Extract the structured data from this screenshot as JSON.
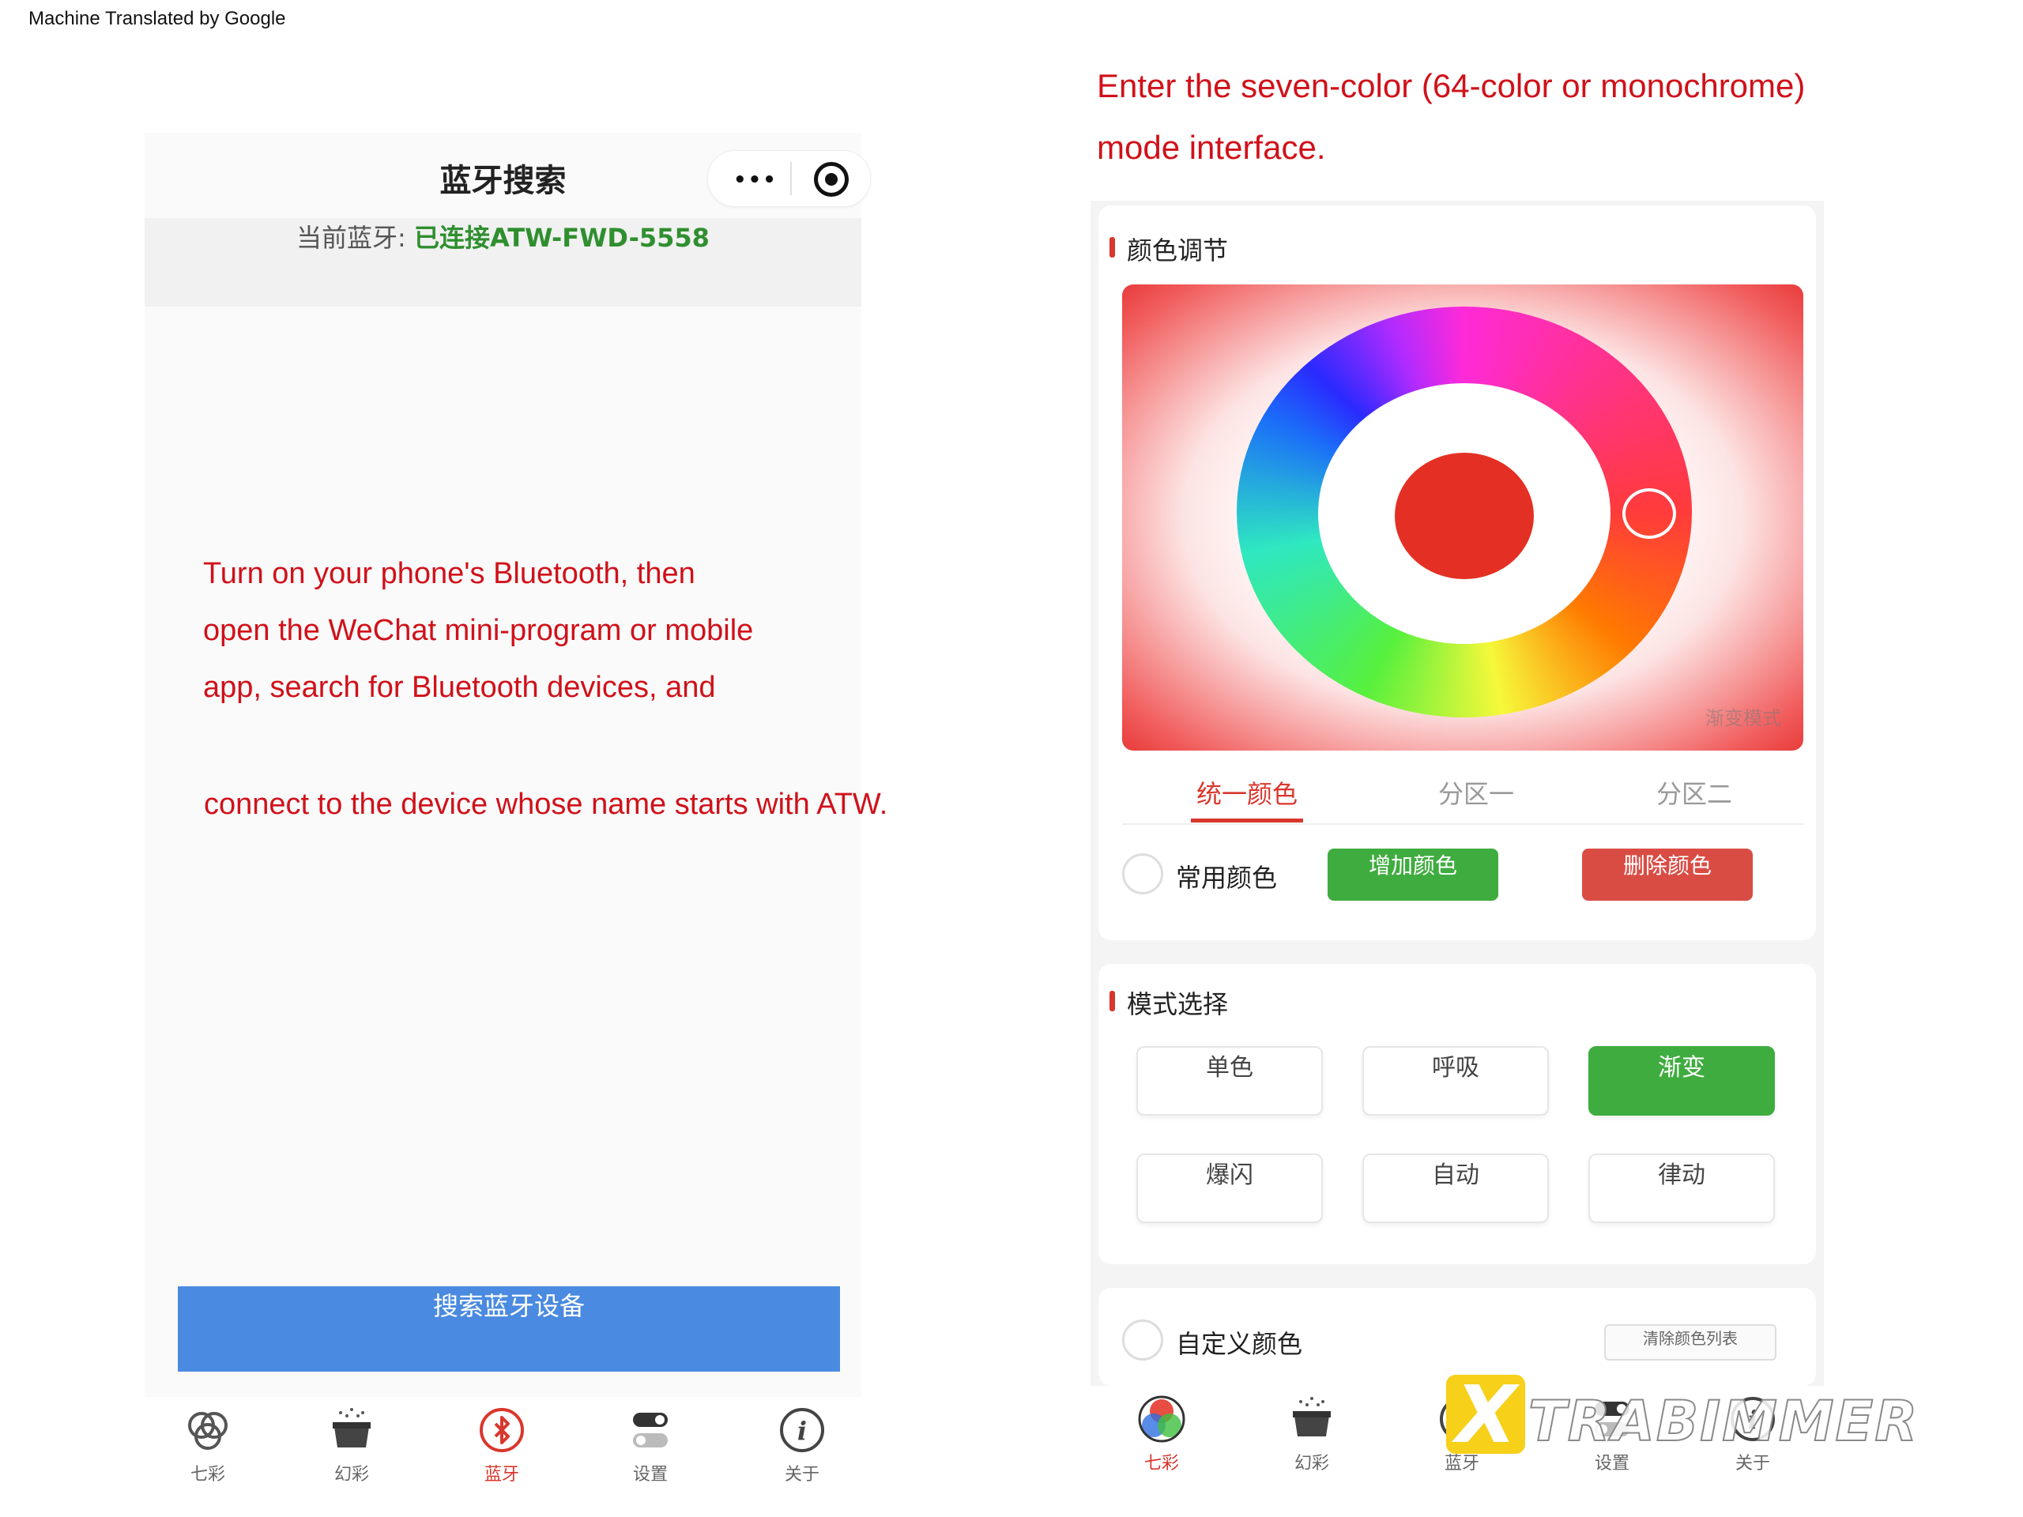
{
  "header_note": "Machine Translated by Google",
  "left_phone": {
    "nav_title": "蓝牙搜索",
    "capsule_more": "•••",
    "status_label": "当前蓝牙:",
    "status_value": "已连接ATW-FWD-5558",
    "search_button": "搜索蓝牙设备",
    "tabs": [
      {
        "label": "七彩",
        "icon": "rings-icon"
      },
      {
        "label": "幻彩",
        "icon": "magic-box-icon"
      },
      {
        "label": "蓝牙",
        "icon": "bluetooth-icon"
      },
      {
        "label": "设置",
        "icon": "toggle-icon"
      },
      {
        "label": "关于",
        "icon": "info-icon"
      }
    ]
  },
  "instructions": {
    "line1": "Turn on your phone's Bluetooth, then",
    "line2": "open the WeChat mini-program or mobile",
    "line3": "app, search for Bluetooth devices, and",
    "line4": "connect to the device whose name starts with ATW."
  },
  "right_note": {
    "line1": "Enter the seven-color (64-color or monochrome)",
    "line2": "mode interface."
  },
  "right_phone": {
    "color_title": "颜色调节",
    "wheel_caption": "渐变模式",
    "segments": [
      "统一颜色",
      "分区一",
      "分区二"
    ],
    "active_segment": "统一颜色",
    "common_color_label": "常用颜色",
    "add_color_button": "增加颜色",
    "delete_color_button": "删除颜色",
    "mode_title": "模式选择",
    "modes": [
      "单色",
      "呼吸",
      "渐变",
      "爆闪",
      "自动",
      "律动"
    ],
    "active_mode": "渐变",
    "custom_color_label": "自定义颜色",
    "clear_list_button": "清除颜色列表",
    "tabs": [
      {
        "label": "七彩",
        "icon": "rgb-circles-icon"
      },
      {
        "label": "幻彩",
        "icon": "magic-box-icon"
      },
      {
        "label": "蓝牙",
        "icon": "bluetooth-icon"
      },
      {
        "label": "设置",
        "icon": "toggle-icon"
      },
      {
        "label": "关于",
        "icon": "info-icon"
      }
    ]
  },
  "colors": {
    "accent_red": "#d9362c",
    "green": "#3fac3f",
    "blue": "#4a8ae0",
    "annotation_red": "#d0111a"
  },
  "watermark": {
    "letter": "X",
    "text": "TRABIMMER"
  }
}
